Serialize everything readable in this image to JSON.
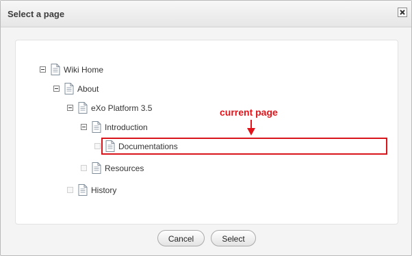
{
  "dialog": {
    "title": "Select a page",
    "close_icon": "close-icon"
  },
  "tree": {
    "nodes": [
      {
        "label": "Wiki Home",
        "expanded": true
      },
      {
        "label": "About",
        "expanded": true
      },
      {
        "label": "eXo Platform 3.5",
        "expanded": true
      },
      {
        "label": "Introduction",
        "expanded": true
      },
      {
        "label": "Documentations",
        "expanded": false
      },
      {
        "label": "Resources",
        "expanded": false
      },
      {
        "label": "History",
        "expanded": false
      }
    ]
  },
  "annotation": {
    "text": "current page",
    "color": "#e0141a"
  },
  "buttons": {
    "cancel": "Cancel",
    "select": "Select"
  }
}
